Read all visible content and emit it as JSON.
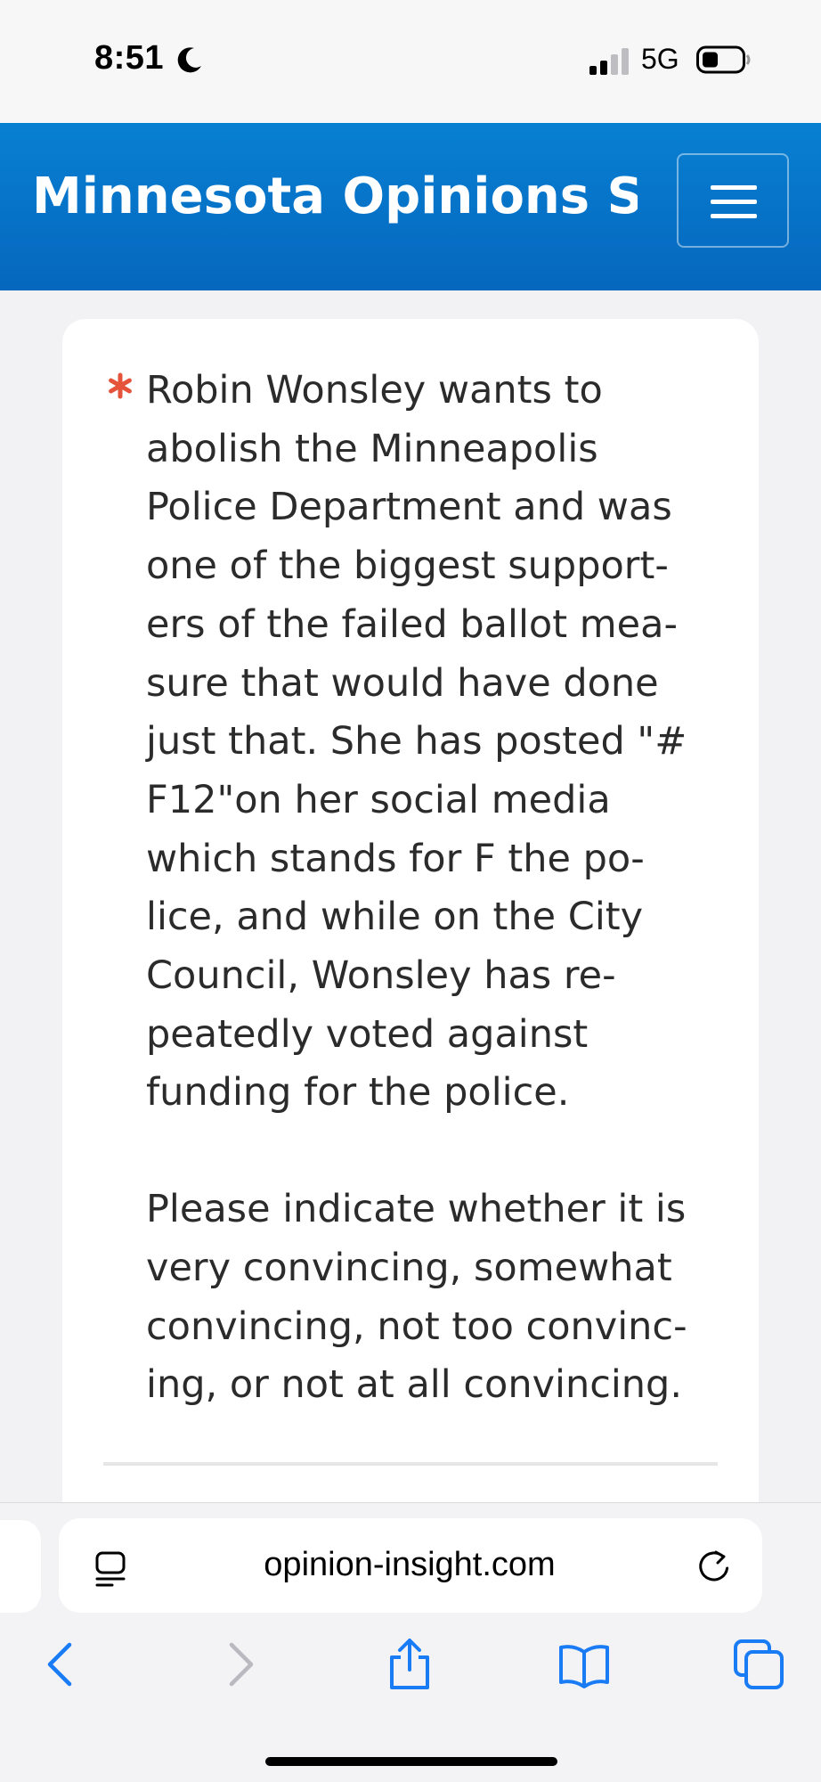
{
  "status_bar": {
    "time": "8:51",
    "network": "5G",
    "icons": [
      "moon-icon",
      "signal-icon",
      "battery-icon"
    ]
  },
  "header": {
    "title": "Minnesota Opinions S...",
    "menu_icon": "hamburger-menu-icon",
    "background_color": "#0573c8"
  },
  "question": {
    "required_marker_color": "#e5533b",
    "paragraph_1": "Robin Wonsley wants to abolish the Minneapolis Police Department and was one of the biggest supporters of the failed ballot measure that would have done just that. She has posted \"# F12\"on her social media which stands for F the police, and while on the City Council, Wonsley has repeatedly voted against funding for the police.",
    "paragraph_2": "Please indicate whether it is very convincing, somewhat convincing, not too convincing, or not at all convincing."
  },
  "browser": {
    "url": "opinion-insight.com",
    "accent_color": "#1a7cf5",
    "toolbar_icons": [
      "chevron-left-icon",
      "chevron-right-icon",
      "share-icon",
      "bookmarks-icon",
      "tabs-icon"
    ]
  }
}
